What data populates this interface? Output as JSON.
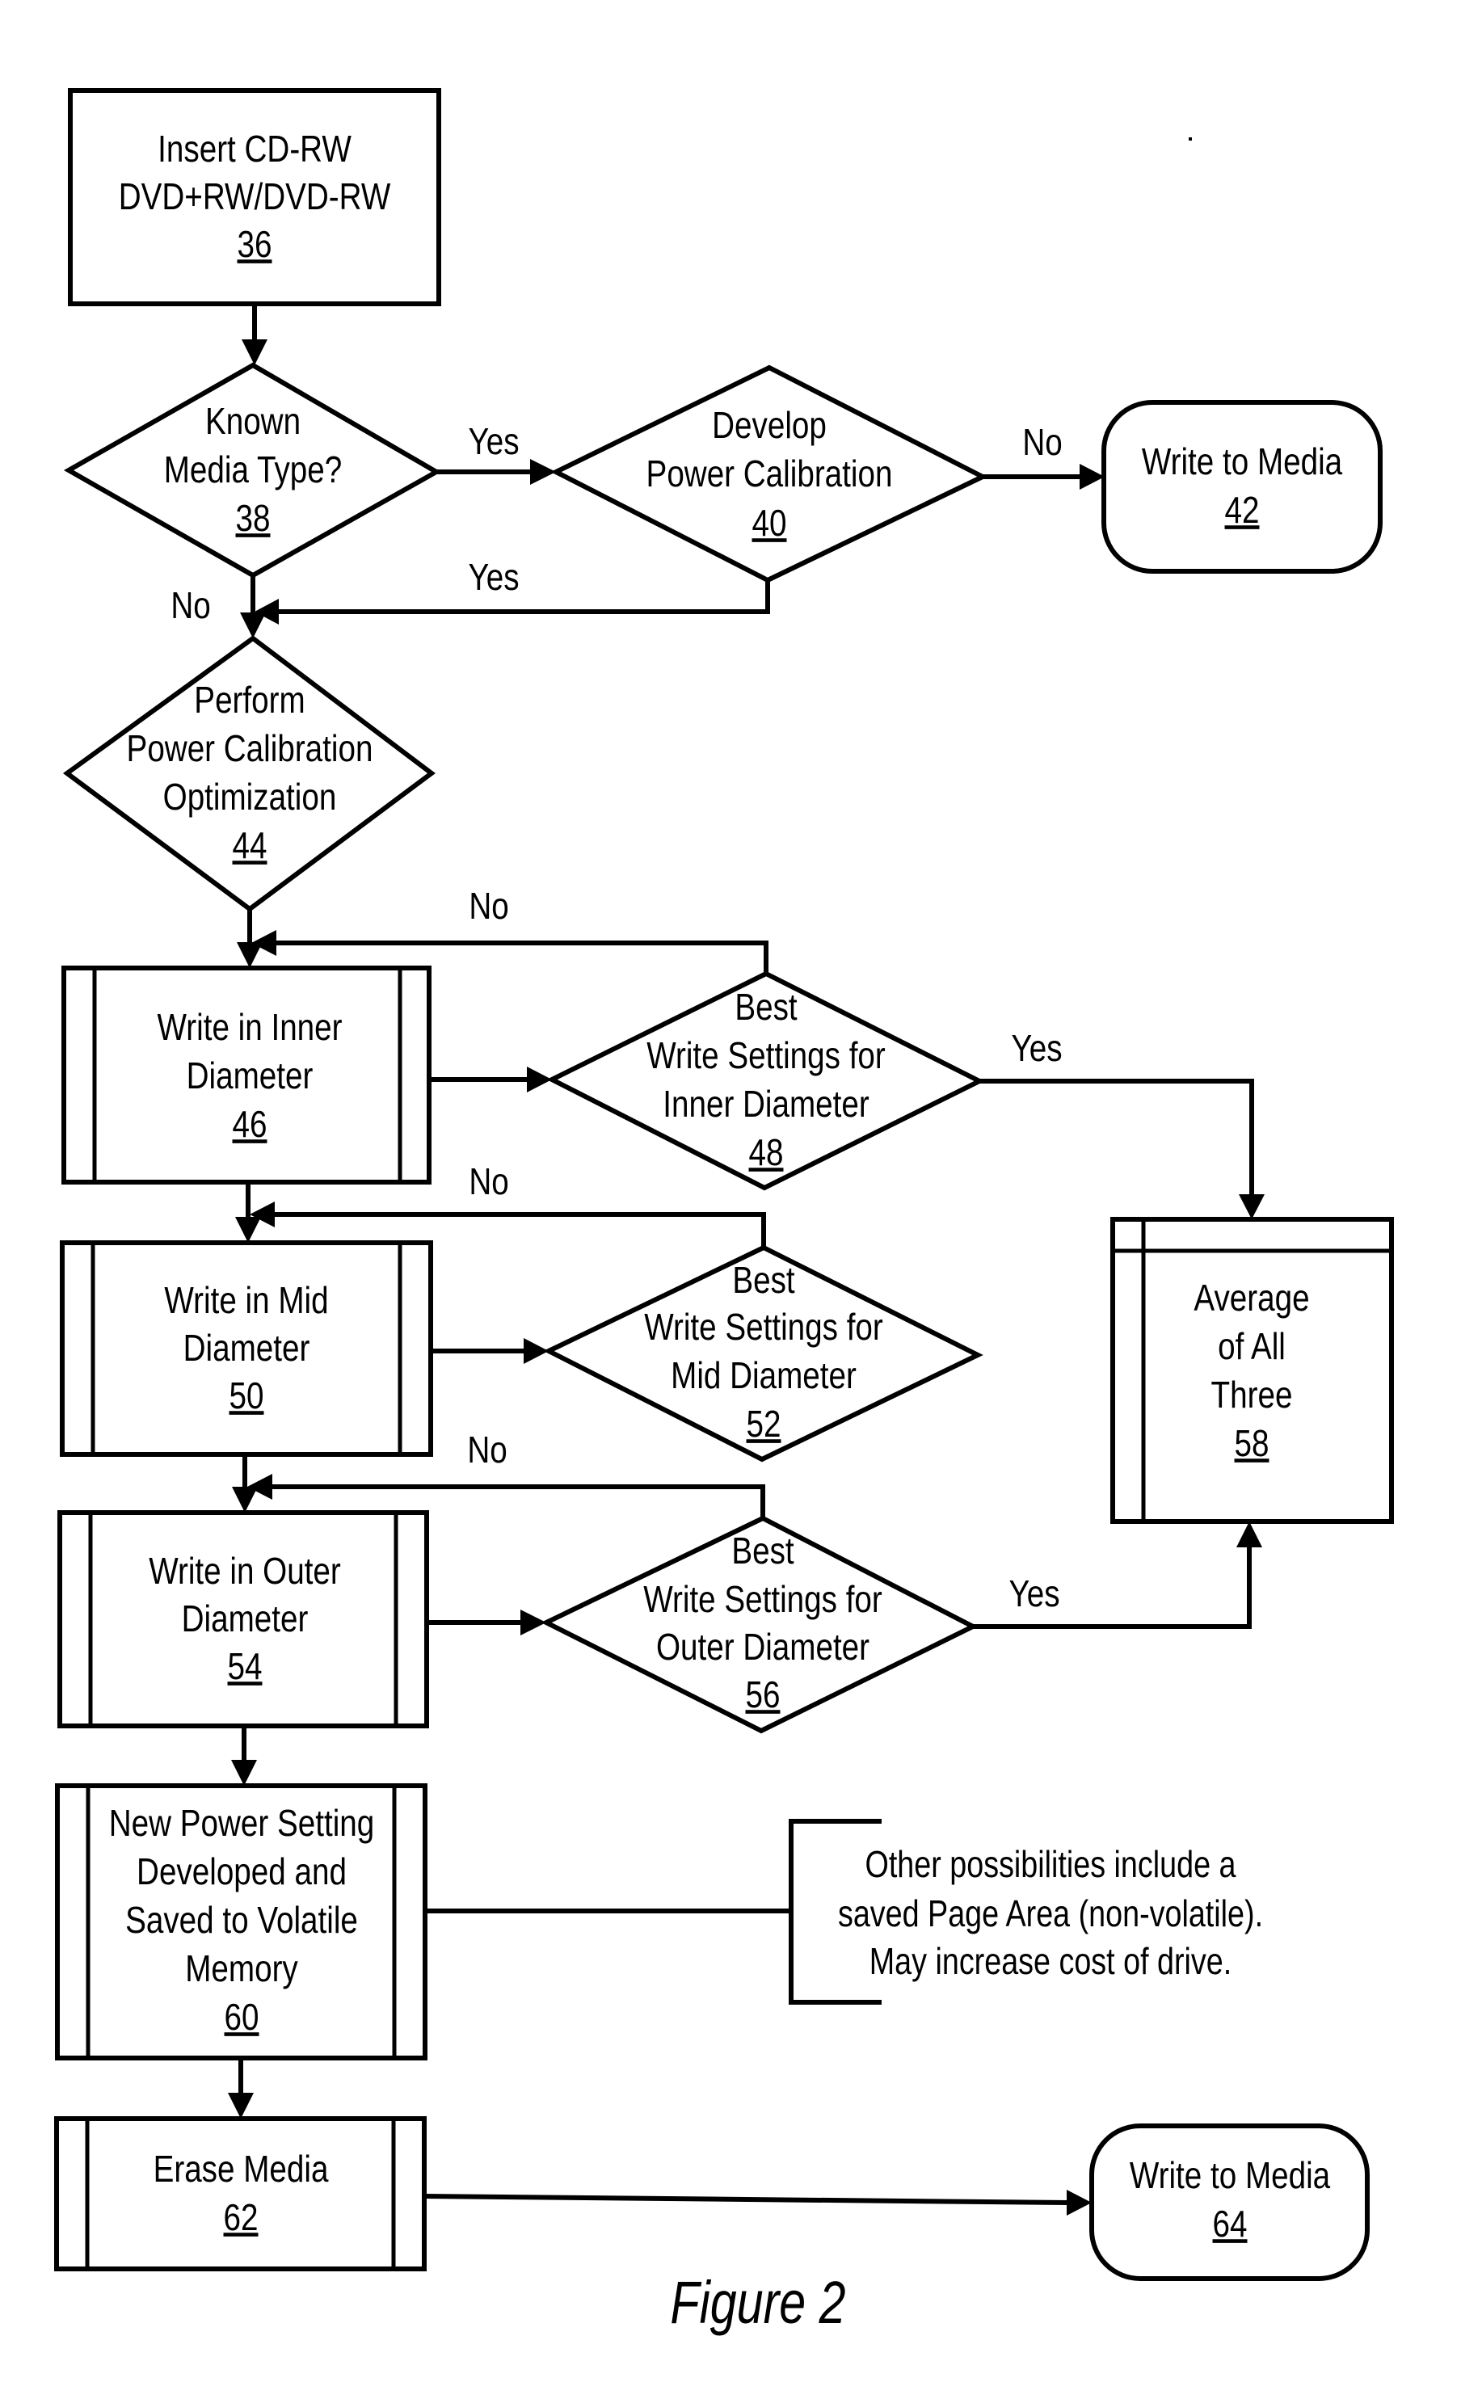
{
  "figure": {
    "caption": "Figure 2",
    "nodes": {
      "n36": {
        "type": "process",
        "lines": [
          "Insert CD-RW",
          "DVD+RW/DVD-RW"
        ],
        "ref": "36"
      },
      "n38": {
        "type": "decision",
        "lines": [
          "Known",
          "Media Type?"
        ],
        "ref": "38"
      },
      "n40": {
        "type": "decision",
        "lines": [
          "Develop",
          "Power Calibration"
        ],
        "ref": "40"
      },
      "n42": {
        "type": "terminal",
        "lines": [
          "Write to Media"
        ],
        "ref": "42"
      },
      "n44": {
        "type": "decision",
        "lines": [
          "Perform",
          "Power Calibration",
          "Optimization"
        ],
        "ref": "44"
      },
      "n46": {
        "type": "predefined-process",
        "lines": [
          "Write in Inner",
          "Diameter"
        ],
        "ref": "46"
      },
      "n48": {
        "type": "decision",
        "lines": [
          "Best",
          "Write Settings for",
          "Inner Diameter"
        ],
        "ref": "48"
      },
      "n50": {
        "type": "predefined-process",
        "lines": [
          "Write in Mid",
          "Diameter"
        ],
        "ref": "50"
      },
      "n52": {
        "type": "decision",
        "lines": [
          "Best",
          "Write Settings for",
          "Mid Diameter"
        ],
        "ref": "52"
      },
      "n54": {
        "type": "predefined-process",
        "lines": [
          "Write in Outer",
          "Diameter"
        ],
        "ref": "54"
      },
      "n56": {
        "type": "decision",
        "lines": [
          "Best",
          "Write Settings for",
          "Outer Diameter"
        ],
        "ref": "56"
      },
      "n58": {
        "type": "internal-storage",
        "lines": [
          "Average",
          "of All",
          "Three"
        ],
        "ref": "58"
      },
      "n60": {
        "type": "predefined-process",
        "lines": [
          "New Power Setting",
          "Developed and",
          "Saved to Volatile",
          "Memory"
        ],
        "ref": "60"
      },
      "n62": {
        "type": "predefined-process",
        "lines": [
          "Erase Media"
        ],
        "ref": "62"
      },
      "n64": {
        "type": "terminal",
        "lines": [
          "Write to Media"
        ],
        "ref": "64"
      }
    },
    "edge_labels": {
      "e38_40": "Yes",
      "e38_44": "No",
      "e40_42": "No",
      "e40_44": "Yes",
      "e48_46": "No",
      "e48_58": "Yes",
      "e52_50": "No",
      "e56_54": "No",
      "e56_58": "Yes"
    },
    "edges": [
      {
        "from": "36",
        "to": "38"
      },
      {
        "from": "38",
        "to": "40",
        "label": "Yes"
      },
      {
        "from": "38",
        "to": "44",
        "label": "No"
      },
      {
        "from": "40",
        "to": "42",
        "label": "No"
      },
      {
        "from": "40",
        "to": "44",
        "label": "Yes"
      },
      {
        "from": "44",
        "to": "46"
      },
      {
        "from": "46",
        "to": "48"
      },
      {
        "from": "48",
        "to": "46",
        "label": "No"
      },
      {
        "from": "48",
        "to": "58",
        "label": "Yes"
      },
      {
        "from": "46",
        "to": "50"
      },
      {
        "from": "50",
        "to": "52"
      },
      {
        "from": "52",
        "to": "50",
        "label": "No"
      },
      {
        "from": "50",
        "to": "54"
      },
      {
        "from": "54",
        "to": "56"
      },
      {
        "from": "56",
        "to": "54",
        "label": "No"
      },
      {
        "from": "56",
        "to": "58",
        "label": "Yes"
      },
      {
        "from": "54",
        "to": "60"
      },
      {
        "from": "60",
        "to": "62"
      },
      {
        "from": "62",
        "to": "64"
      }
    ],
    "annotation": {
      "attached_to": "60",
      "lines": [
        "Other possibilities include a",
        "saved Page Area (non-volatile).",
        "May increase cost of drive."
      ]
    }
  }
}
